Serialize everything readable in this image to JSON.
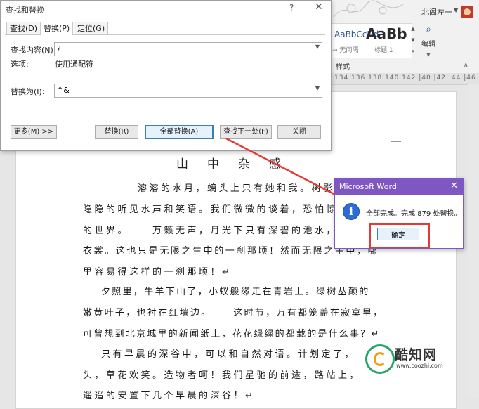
{
  "word": {
    "user_name": "北阁左一",
    "styles": [
      {
        "preview": "AaBbCcDd",
        "label": "→ 无间隔"
      },
      {
        "preview": "AaBb",
        "label": "标题 1"
      }
    ],
    "styles_group_label": "样式",
    "edit_label": "编辑",
    "ruler_text": "134  136  138  140  142  |40  |42  |44  |46  |48"
  },
  "document": {
    "title": "山中杂感",
    "lines": [
      "溶溶的水月，螭头上只有她和我。树影里",
      "隐隐的听见水声和笑语。我们微微的谈着，恐怕惊",
      "的世界。——万籁无声，月光下只有深碧的池水，",
      "衣裳。这也只是无限之生中的一刹那顷！然而无限之生中，哪",
      "里容易得这样的一刹那顷！↵",
      "夕照里，牛羊下山了，小蚁般缘走在青岩上。绿树丛颠的",
      "嫩黄叶子，也衬在红墙边。——这时节，万有都笼盖在寂寞里，",
      "可曾想到北京城里的新闻纸上，花花绿绿的都载的是什么事？↵",
      "只有早晨的深谷中，可以和自然对语。计划定了，",
      "头，草花欢笑。造物者呵！我们星驰的前途，路站上，",
      "遥遥的安置下几个早晨的深谷！↵"
    ]
  },
  "find_replace": {
    "title": "查找和替换",
    "help": "?",
    "close": "✕",
    "tabs": [
      "查找(D)",
      "替换(P)",
      "定位(G)"
    ],
    "find_label": "查找内容(N):",
    "find_value": "?",
    "options_label": "选项:",
    "options_value": "使用通配符",
    "replace_label": "替换为(I):",
    "replace_value": "^&",
    "buttons": {
      "more": "更多(M) >>",
      "replace": "替换(R)",
      "replace_all": "全部替换(A)",
      "find_next": "查找下一处(F)",
      "close": "关闭"
    }
  },
  "message_box": {
    "title": "Microsoft Word",
    "close": "✕",
    "icon_glyph": "i",
    "text": "全部完成。完成 879 处替换。",
    "ok": "确定"
  },
  "watermark": {
    "name": "酷知网",
    "url": "www.coozhi.com"
  },
  "colors": {
    "message_title": "#7e57c2",
    "highlight": "#e53935",
    "info_icon": "#2b6cd8"
  }
}
